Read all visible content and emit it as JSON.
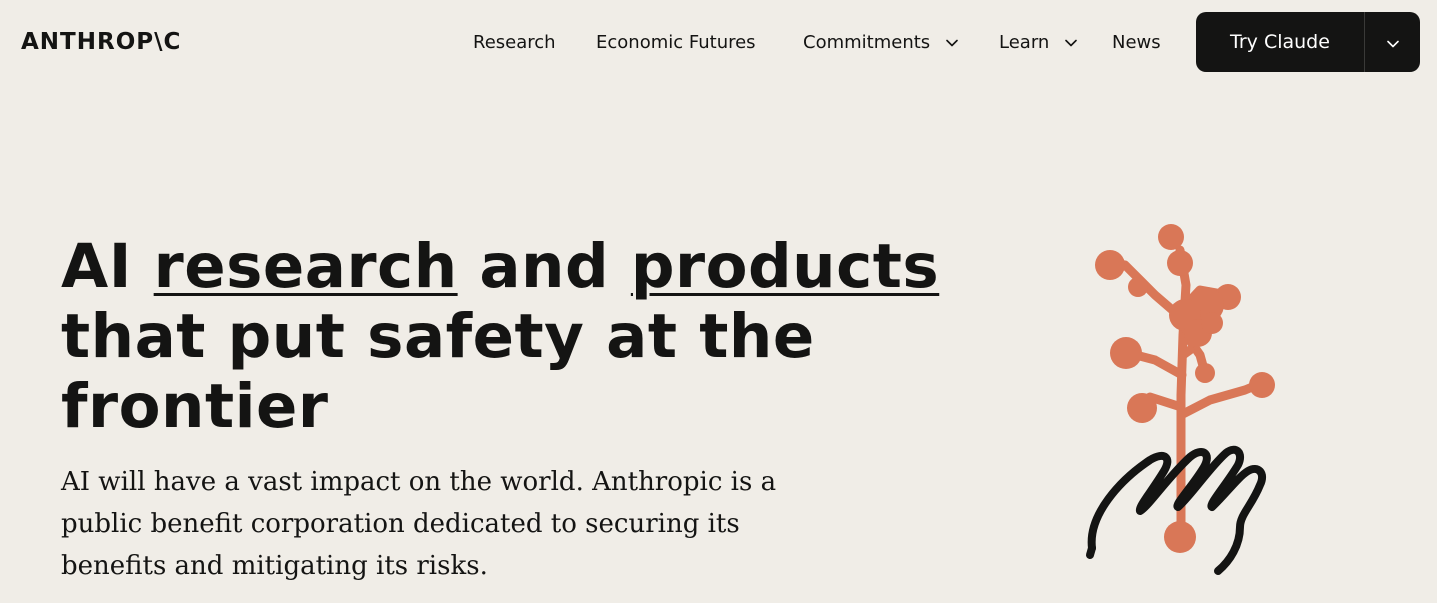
{
  "header": {
    "logo": "ANTHROP\\C",
    "nav": [
      {
        "label": "Research"
      },
      {
        "label": "Economic Futures"
      },
      {
        "label": "Commitments",
        "icon": "chevron-down-icon"
      },
      {
        "label": "Learn",
        "icon": "chevron-down-icon"
      },
      {
        "label": "News"
      }
    ],
    "cta": {
      "label": "Try Claude",
      "toggle_icon": "chevron-down-icon"
    }
  },
  "hero": {
    "title": {
      "part1": "AI ",
      "link1": "research",
      "part2": " and ",
      "link2": "products",
      "part3": " that put safety at the frontier"
    },
    "subtitle": "AI will have a vast impact on the world. Anthropic is a public benefit corporation dedicated to securing its benefits and mitigating its risks.",
    "illustration": "hand-holding-plant-illustration"
  },
  "colors": {
    "background": "#f0ede7",
    "text": "#141413",
    "accent": "#d97757",
    "button": "#141413"
  }
}
